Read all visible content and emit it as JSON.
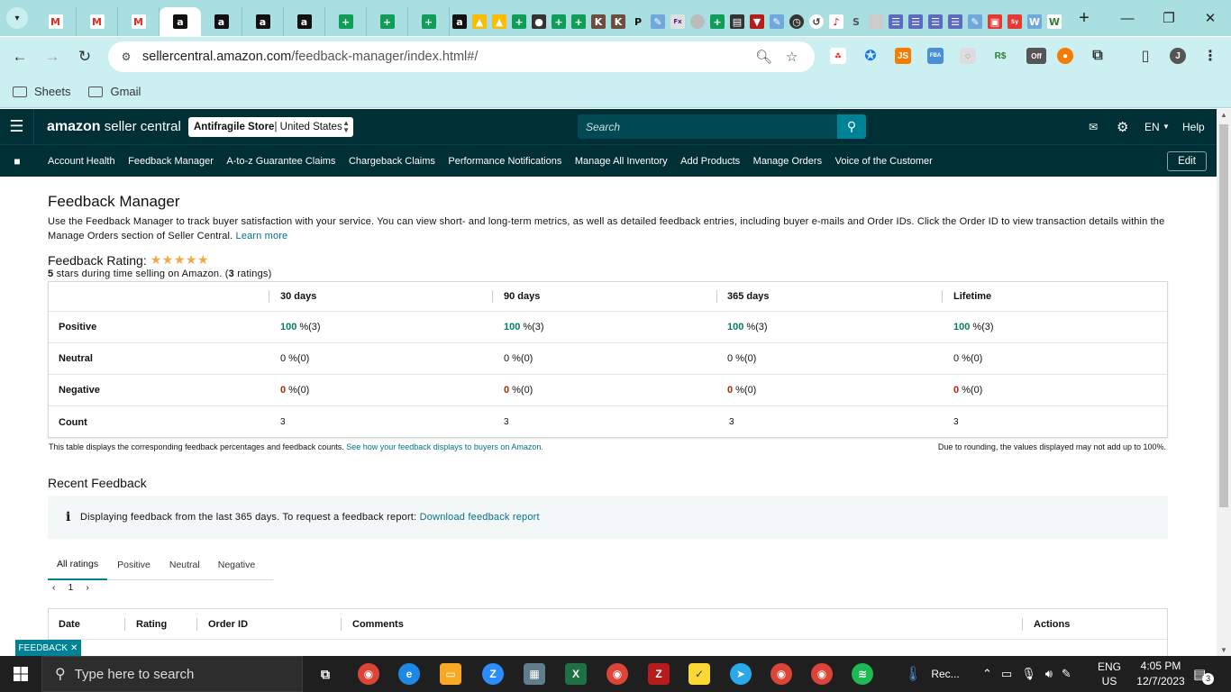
{
  "browser": {
    "url_host": "sellercentral.amazon.com",
    "url_path": "/feedback-manager/index.html#/",
    "bookmarks": [
      "Sheets",
      "Gmail"
    ],
    "profile_initial": "J",
    "ext_off_label": "Off"
  },
  "header": {
    "logo_bold": "amazon",
    "logo_rest": " seller central",
    "store_bold": "Antifragile Store",
    "store_rest": " | United States",
    "search_placeholder": "Search",
    "language": "EN",
    "help": "Help"
  },
  "subnav": {
    "items": [
      "Account Health",
      "Feedback Manager",
      "A-to-z Guarantee Claims",
      "Chargeback Claims",
      "Performance Notifications",
      "Manage All Inventory",
      "Add Products",
      "Manage Orders",
      "Voice of the Customer"
    ],
    "edit": "Edit"
  },
  "page": {
    "title": "Feedback Manager",
    "intro": "Use the Feedback Manager to track buyer satisfaction with your service. You can view short- and long-term metrics, as well as detailed feedback entries, including buyer e-mails and Order IDs. Click the Order ID to view transaction details within the Manage Orders section of Seller Central.",
    "learn_more": "Learn more",
    "rating_title": "Feedback Rating:",
    "stars": "★★★★★",
    "rating_sub_bold": "5",
    "rating_sub": " stars during time selling on Amazon. (",
    "rating_count": "3",
    "rating_sub_end": " ratings)"
  },
  "feedback_table": {
    "columns": [
      "30 days",
      "90 days",
      "365 days",
      "Lifetime"
    ],
    "rows": [
      {
        "label": "Positive",
        "cells": [
          [
            "100",
            " %(3)"
          ],
          [
            "100",
            " %(3)"
          ],
          [
            "100",
            " %(3)"
          ],
          [
            "100",
            " %(3)"
          ]
        ]
      },
      {
        "label": "Neutral",
        "cells": [
          [
            "0",
            " %(0)"
          ],
          [
            "0",
            " %(0)"
          ],
          [
            "0",
            " %(0)"
          ],
          [
            "0",
            " %(0)"
          ]
        ]
      },
      {
        "label": "Negative",
        "cells": [
          [
            "0",
            " %(0)"
          ],
          [
            "0",
            " %(0)"
          ],
          [
            "0",
            " %(0)"
          ],
          [
            "0",
            " %(0)"
          ]
        ]
      },
      {
        "label": "Count",
        "cells": [
          [
            "3",
            ""
          ],
          [
            "3",
            ""
          ],
          [
            "3",
            ""
          ],
          [
            "3",
            ""
          ]
        ]
      }
    ],
    "footnote_left": "This table displays the corresponding feedback percentages and feedback counts.",
    "footnote_link": "See how your feedback displays to buyers on Amazon.",
    "footnote_right": "Due to rounding, the values displayed may not add up to 100%."
  },
  "recent": {
    "title": "Recent Feedback",
    "info_text": "Displaying feedback from the last 365 days. To request a feedback report:",
    "info_link": "Download feedback report",
    "tabs": [
      "All ratings",
      "Positive",
      "Neutral",
      "Negative"
    ],
    "page": "1",
    "columns": [
      "Date",
      "Rating",
      "Order ID",
      "Comments",
      "Actions"
    ],
    "feedback_badge": "FEEDBACK ✕"
  },
  "taskbar": {
    "search_placeholder": "Type here to search",
    "task_label": "Rec...",
    "lang_top": "ENG",
    "lang_bottom": "US",
    "time": "4:05 PM",
    "date": "12/7/2023",
    "notifications": "3"
  }
}
